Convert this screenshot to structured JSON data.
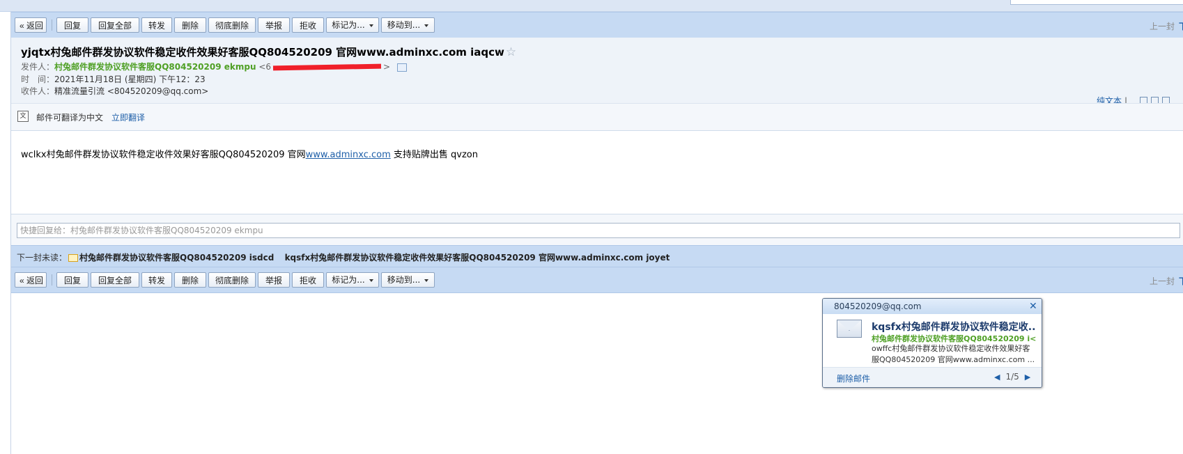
{
  "toolbar": {
    "back": "« 返回",
    "reply": "回复",
    "reply_all": "回复全部",
    "forward": "转发",
    "delete": "删除",
    "delete_perm": "彻底删除",
    "report": "举报",
    "reject": "拒收",
    "mark_as": "标记为...",
    "move_to": "移动到...",
    "prev": "上一封",
    "next": "下"
  },
  "email": {
    "subject": "yjqtx村兔邮件群发协议软件稳定收件效果好客服QQ804520209 官网www.adminxc.com iaqcw",
    "star": "☆",
    "from_label": "发件人：",
    "from_name": "村兔邮件群发协议软件客服QQ804520209 ekmpu",
    "from_addr_start": "<6",
    "from_addr_end": ">",
    "time_label": "时　间：",
    "time_value": "2021年11月18日 (星期四) 下午12：23",
    "to_label": "收件人：",
    "to_value": "精准流量引流 <804520209@qq.com>",
    "plain_text": "纯文本",
    "plain_sep": "|"
  },
  "translate": {
    "text": "邮件可翻译为中文",
    "link": "立即翻译",
    "icon": "translate-icon"
  },
  "body": {
    "pre": "wclkx村兔邮件群发协议软件稳定收件效果好客服QQ804520209 官网",
    "link": "www.adminxc.com",
    "post": " 支持贴牌出售 qvzon"
  },
  "quick_reply": {
    "placeholder": "快捷回复给：村兔邮件群发协议软件客服QQ804520209  ekmpu"
  },
  "next_unread": {
    "label": "下一封未读：",
    "sender": "村兔邮件群发协议软件客服QQ804520209  isdcd",
    "subject": "kqsfx村兔邮件群发协议软件稳定收件效果好客服QQ804520209 官网www.adminxc.com joyet"
  },
  "popup": {
    "account": "804520209@qq.com",
    "close": "✕",
    "subject": "kqsfx村兔邮件群发协议软件稳定收...",
    "sender": "村兔邮件群发协议软件客服QQ804520209  i<...",
    "snippet": "owffc村兔邮件群发协议软件稳定收件效果好客服QQ804520209 官网www.adminxc.com ...",
    "delete": "删除邮件",
    "prev_arrow": "◀",
    "next_arrow": "▶",
    "pager": "1/5"
  },
  "colors": {
    "toolbar_bg": "#c6daf3",
    "header_bg": "#eef3f9",
    "link": "#1e5fa8",
    "sender_green": "#4fa025",
    "redaction": "#f0202a"
  }
}
